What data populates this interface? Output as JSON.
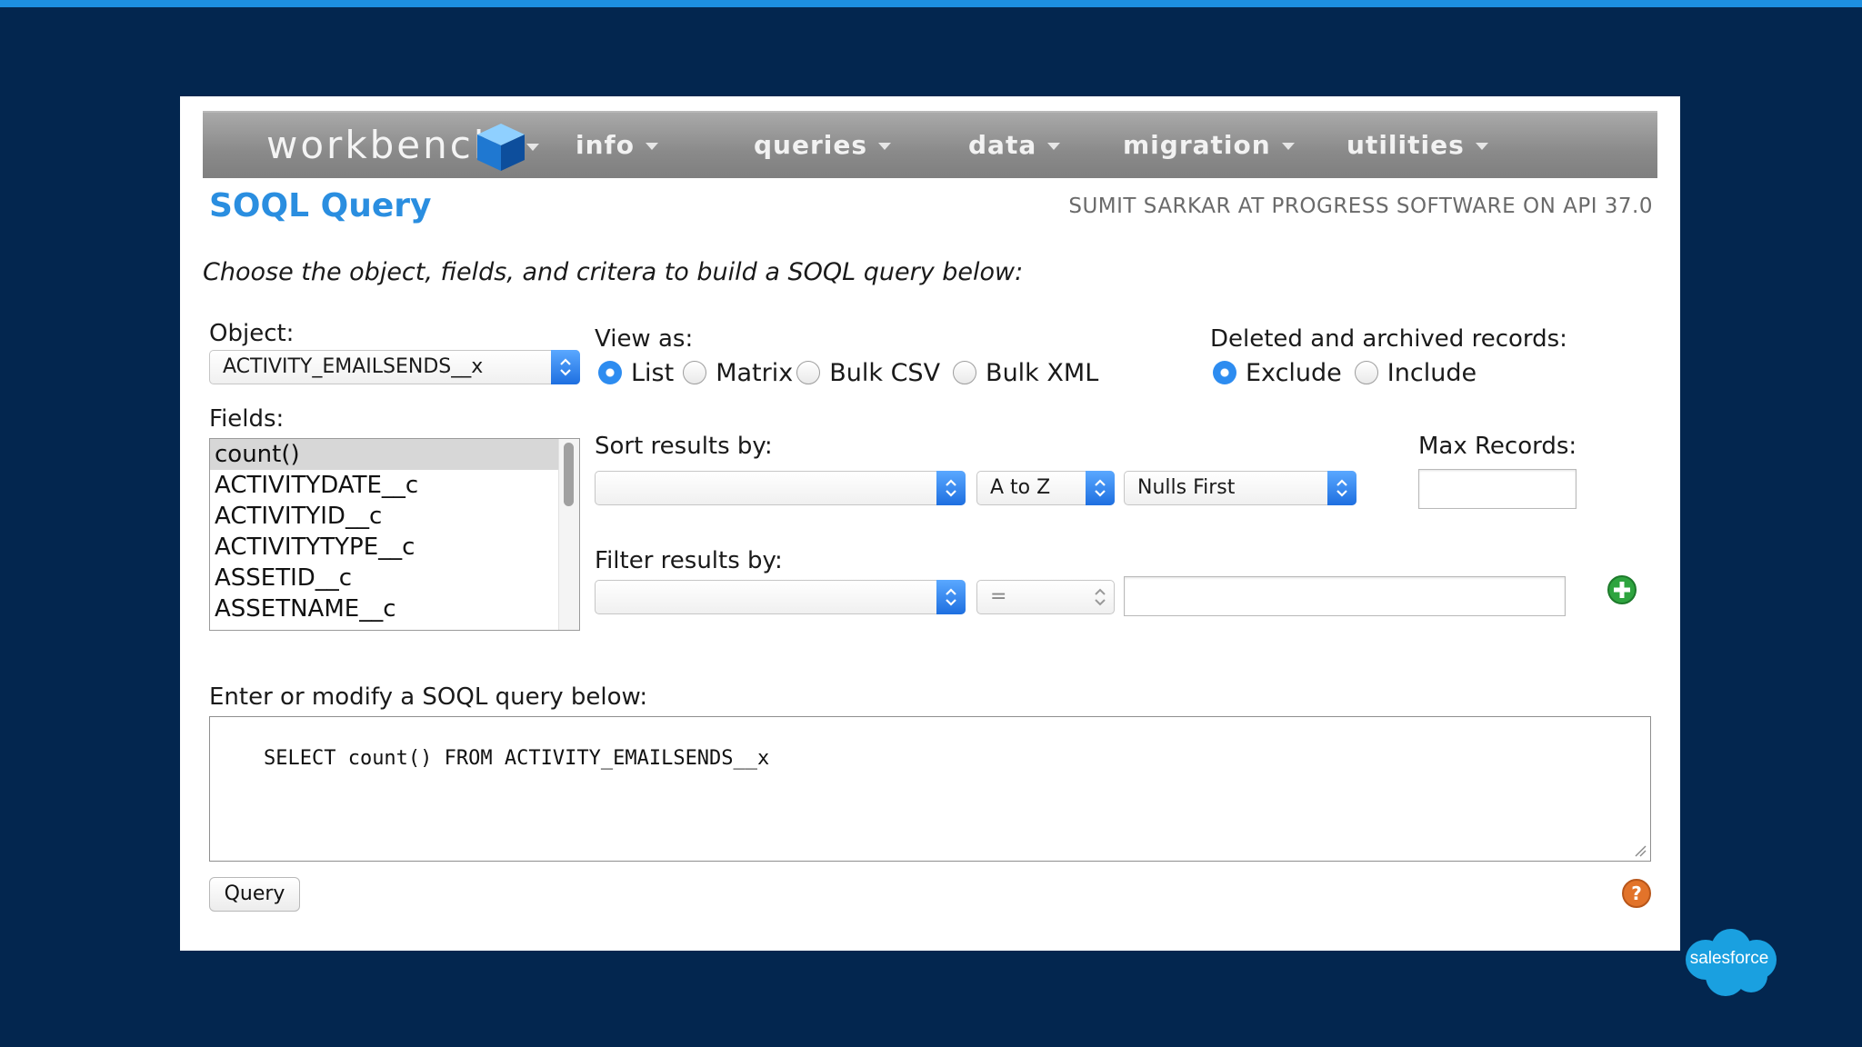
{
  "app": {
    "brand": "workbench",
    "nav": [
      "info",
      "queries",
      "data",
      "migration",
      "utilities"
    ]
  },
  "page": {
    "title": "SOQL Query",
    "user_info": "SUMIT SARKAR AT PROGRESS SOFTWARE ON API 37.0",
    "instructions": "Choose the object, fields, and critera to build a SOQL query below:"
  },
  "object": {
    "label": "Object:",
    "value": "ACTIVITY_EMAILSENDS__x"
  },
  "view_as": {
    "label": "View as:",
    "options": [
      "List",
      "Matrix",
      "Bulk CSV",
      "Bulk XML"
    ],
    "selected": "List"
  },
  "deleted": {
    "label": "Deleted and archived records:",
    "options": [
      "Exclude",
      "Include"
    ],
    "selected": "Exclude"
  },
  "fields": {
    "label": "Fields:",
    "items": [
      "count()",
      "ACTIVITYDATE__c",
      "ACTIVITYID__c",
      "ACTIVITYTYPE__c",
      "ASSETID__c",
      "ASSETNAME__c"
    ],
    "selected": "count()"
  },
  "sort": {
    "label": "Sort results by:",
    "field": "",
    "direction": "A to Z",
    "nulls": "Nulls First"
  },
  "max_records": {
    "label": "Max Records:",
    "value": ""
  },
  "filter": {
    "label": "Filter results by:",
    "field": "",
    "operator": "=",
    "value": ""
  },
  "query": {
    "label": "Enter or modify a SOQL query below:",
    "text": "SELECT count() FROM ACTIVITY_EMAILSENDS__x",
    "button": "Query"
  },
  "footer": {
    "logo": "salesforce"
  },
  "colors": {
    "background": "#03264f",
    "accent_bar": "#1d8fe0",
    "title": "#2a8ee0",
    "select_arrow": "#1e6fe0"
  }
}
